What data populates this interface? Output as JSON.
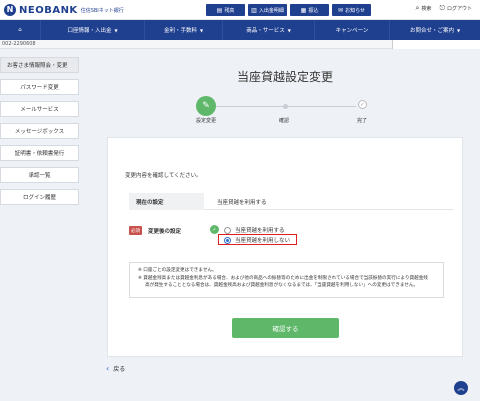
{
  "header": {
    "logo_mark": "N",
    "logo_text": "NEOBANK",
    "logo_sub": "住信SBIネット銀行",
    "buttons": [
      {
        "label": "残高",
        "icon": "balance-icon"
      },
      {
        "label": "入出金明細",
        "icon": "statement-icon"
      },
      {
        "label": "振込",
        "icon": "transfer-icon"
      },
      {
        "label": "お知らせ",
        "icon": "mail-icon"
      }
    ],
    "search_label": "検索",
    "logout_label": "ログアウト"
  },
  "nav": {
    "home_icon": "home-icon",
    "items": [
      "口座情報・入出金",
      "金利・手数料",
      "商品・サービス",
      "キャンペーン",
      "お問合せ・ご案内"
    ]
  },
  "account_number": "002-2290608",
  "sidebar": {
    "items": [
      "お客さま情報照会・変更",
      "パスワード変更",
      "メールサービス",
      "メッセージボックス",
      "証明書・依頼書発行",
      "承認一覧",
      "ログイン履歴"
    ]
  },
  "page_title": "当座貸越設定変更",
  "steps": [
    {
      "label": "設定変更",
      "icon": "pencil-icon"
    },
    {
      "label": "確認"
    },
    {
      "label": "完了",
      "icon": "check-icon"
    }
  ],
  "form": {
    "intro": "変更内容を確認してください。",
    "current_label": "現在の設定",
    "current_value": "当座貸越を利用する",
    "required_badge": "必須",
    "new_label": "変更後の設定",
    "options": [
      {
        "label": "当座貸越を利用する",
        "selected": false
      },
      {
        "label": "当座貸越を利用しない",
        "selected": true
      }
    ],
    "notes": [
      "※ 口座ごとの設定変更はできません。",
      "※ 貸越金残高または貸越金利息がある場合、および他の商品への振替等のために出金を制限されている場合で当該振替の実行により貸越金残",
      "高が発生することとなる場合は、貸越金残高および貸越金利息がなくなるまでは、「当座貸越を利用しない」への変更はできません。"
    ],
    "confirm_label": "確認する"
  },
  "back_label": "戻る",
  "colors": {
    "brand": "#1f3f8f",
    "accent_green": "#5fb86a",
    "required_red": "#c9524e",
    "highlight": "#e02020"
  }
}
